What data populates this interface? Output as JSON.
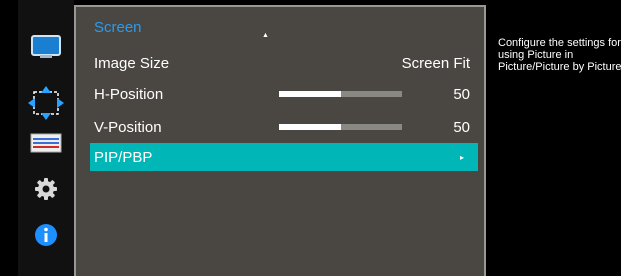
{
  "menu": {
    "title": "Screen",
    "scroll_up_glyph": "▲",
    "items": [
      {
        "label": "Image Size",
        "value": "Screen Fit"
      },
      {
        "label": "H-Position",
        "value": "50",
        "level": 0.5
      },
      {
        "label": "V-Position",
        "value": "50",
        "level": 0.5
      },
      {
        "label": "PIP/PBP",
        "arrow": "▸",
        "selected": true
      }
    ]
  },
  "sidebar": {
    "icons": [
      "monitor-icon",
      "position-arrows-icon",
      "pip-bars-icon",
      "settings-gear-icon",
      "info-icon"
    ],
    "active_index": 1
  },
  "help": {
    "text": "Configure the settings for using Picture in Picture/Picture by Picture."
  },
  "colors": {
    "accent_blue": "#2a9bf0",
    "selection_teal": "#00b6b6",
    "panel_gray": "#4a4742"
  }
}
